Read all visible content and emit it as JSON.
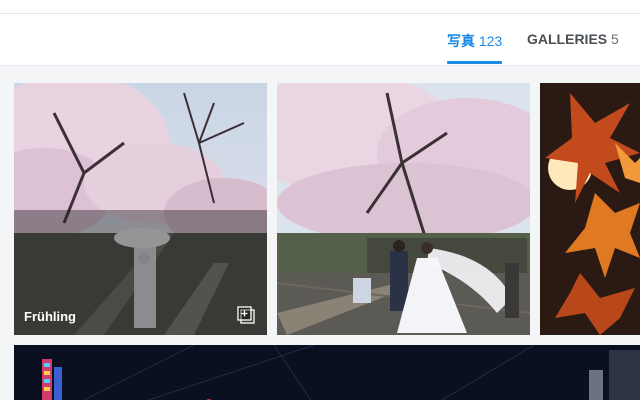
{
  "tabs": [
    {
      "label": "写真",
      "count": "123",
      "active": true
    },
    {
      "label": "GALLERIES",
      "count": "5",
      "active": false
    }
  ],
  "tiles": [
    {
      "title": "Frühling",
      "icon": "gallery-stack-icon",
      "subject": "cherry blossoms with kimono figure on railway"
    },
    {
      "subject": "wedding couple under cherry blossoms on railway"
    },
    {
      "subject": "autumn maple leaves"
    },
    {
      "subject": "night city neon"
    }
  ],
  "colors": {
    "accent": "#1a8ae6",
    "tab_text": "#4a4f55",
    "background": "#f3f5f7"
  }
}
